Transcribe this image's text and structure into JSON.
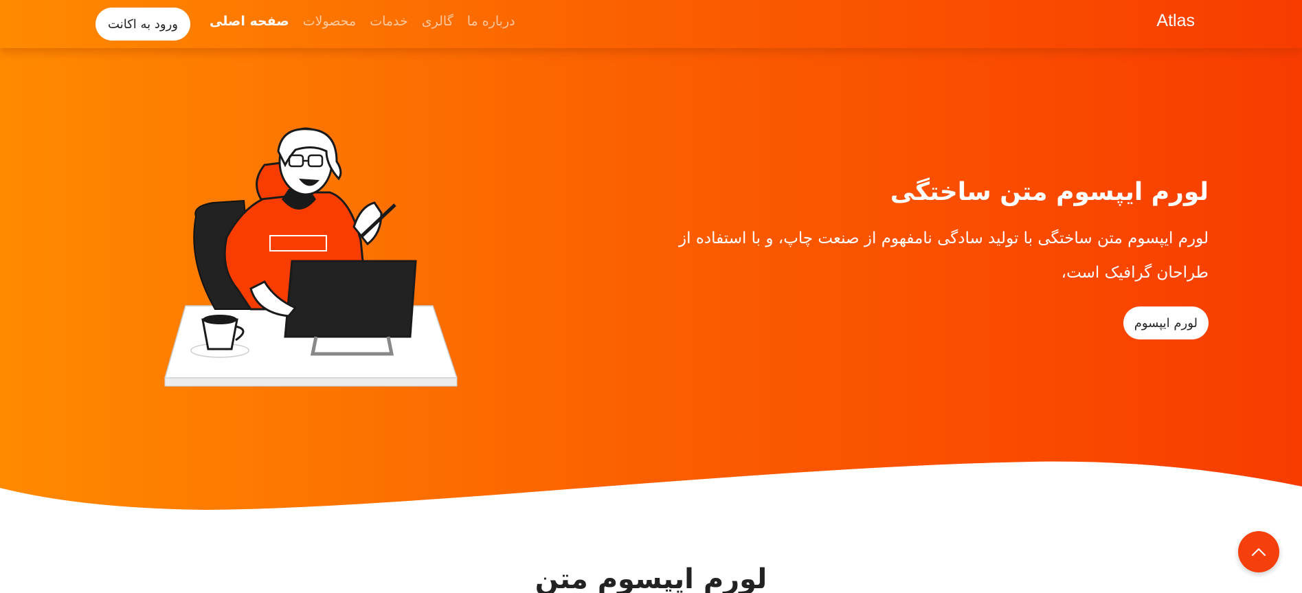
{
  "navbar": {
    "brand": "Atlas",
    "links": [
      {
        "label": "صفحه اصلی",
        "active": true
      },
      {
        "label": "محصولات"
      },
      {
        "label": "خدمات"
      },
      {
        "label": "گالری"
      },
      {
        "label": "درباره ما"
      }
    ],
    "login_label": "ورود به اکانت"
  },
  "hero": {
    "title": "لورم ایپسوم متن ساختگی",
    "description": "لورم ایپسوم متن ساختگی با تولید سادگی نامفهوم از صنعت چاپ، و با استفاده از طراحان گرافیک است،",
    "button_label": "لورم ایپسوم"
  },
  "section": {
    "title": "لورم ایپسوم متن"
  },
  "colors": {
    "gradient_start": "#ff8a00",
    "gradient_end": "#f83c00",
    "accent": "#f5400b"
  },
  "icons": {
    "scroll_top": "chevron-up-icon"
  }
}
